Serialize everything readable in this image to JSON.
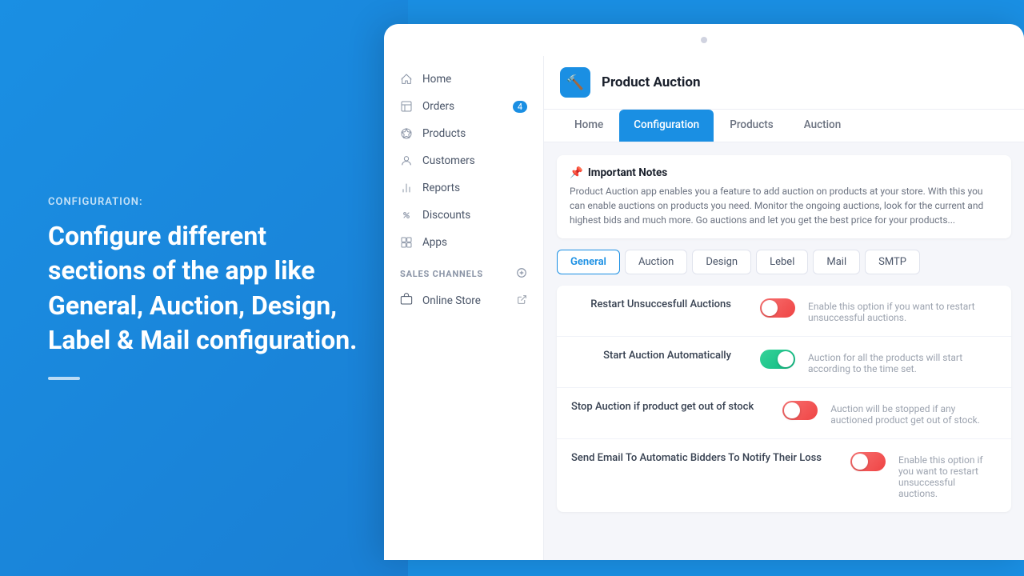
{
  "left": {
    "config_label": "CONFIGURATION:",
    "heading": "Configure different sections of the app like General, Auction, Design, Label & Mail configuration."
  },
  "sidebar": {
    "items": [
      {
        "id": "home",
        "label": "Home",
        "icon": "home",
        "badge": null
      },
      {
        "id": "orders",
        "label": "Orders",
        "icon": "orders",
        "badge": "4"
      },
      {
        "id": "products",
        "label": "Products",
        "icon": "products",
        "badge": null
      },
      {
        "id": "customers",
        "label": "Customers",
        "icon": "customers",
        "badge": null
      },
      {
        "id": "reports",
        "label": "Reports",
        "icon": "reports",
        "badge": null
      },
      {
        "id": "discounts",
        "label": "Discounts",
        "icon": "discounts",
        "badge": null
      },
      {
        "id": "apps",
        "label": "Apps",
        "icon": "apps",
        "badge": null
      }
    ],
    "sales_channels_label": "SALES CHANNELS",
    "online_store_label": "Online Store"
  },
  "app_header": {
    "title": "Product Auction",
    "logo_icon": "🔨"
  },
  "nav_tabs": [
    {
      "id": "home",
      "label": "Home"
    },
    {
      "id": "configuration",
      "label": "Configuration",
      "active": true
    },
    {
      "id": "products",
      "label": "Products"
    },
    {
      "id": "auction",
      "label": "Auction"
    }
  ],
  "important_notes": {
    "title": "Important Notes",
    "icon": "📌",
    "text": "Product Auction app enables you a feature to add auction on products at your store. With this you can enable auctions on products you need. Monitor the ongoing auctions, look for the current and highest bids and much more. Go auctions and let you get the best price for your products..."
  },
  "config_tabs": [
    {
      "id": "general",
      "label": "General",
      "active": true
    },
    {
      "id": "auction",
      "label": "Auction"
    },
    {
      "id": "design",
      "label": "Design"
    },
    {
      "id": "label",
      "label": "Lebel"
    },
    {
      "id": "mail",
      "label": "Mail"
    },
    {
      "id": "smtp",
      "label": "SMTP"
    }
  ],
  "settings": [
    {
      "id": "restart",
      "label": "Restart Unsuccesfull Auctions",
      "desc": "Enable this option if you want to restart unsuccessful auctions.",
      "enabled": false
    },
    {
      "id": "start-auto",
      "label": "Start Auction Automatically",
      "desc": "Auction for all the products will start according to the time set.",
      "enabled": true
    },
    {
      "id": "stop-out-of-stock",
      "label": "Stop Auction if product get out of stock",
      "desc": "Auction will be stopped if any auctioned product get out of stock.",
      "enabled": false
    },
    {
      "id": "send-email",
      "label": "Send Email To Automatic Bidders To Notify Their Loss",
      "desc": "Enable this option if you want to restart unsuccessful auctions.",
      "enabled": false
    }
  ]
}
